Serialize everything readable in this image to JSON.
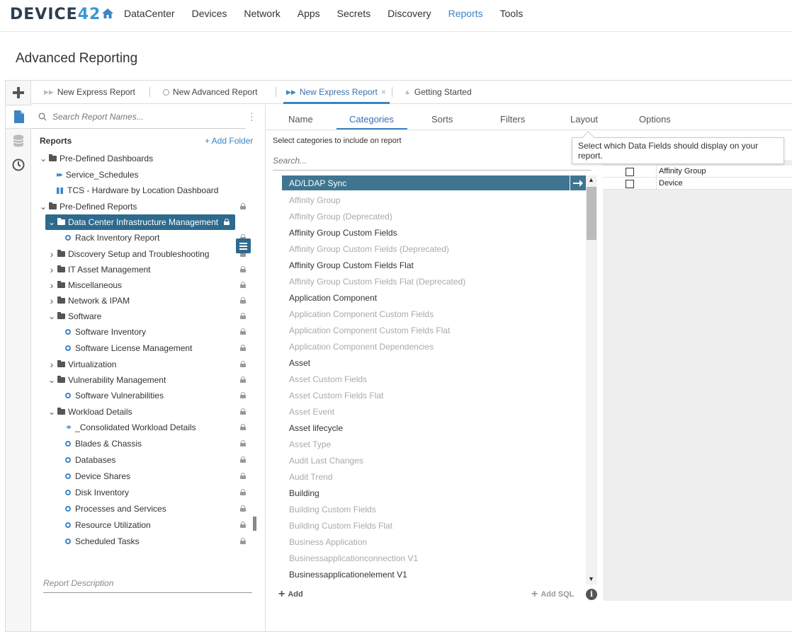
{
  "topnav": {
    "logo_text": "DEVICE",
    "logo_num": "42",
    "items": [
      {
        "label": "DataCenter"
      },
      {
        "label": "Devices"
      },
      {
        "label": "Network"
      },
      {
        "label": "Apps"
      },
      {
        "label": "Secrets"
      },
      {
        "label": "Discovery"
      },
      {
        "label": "Reports",
        "active": true
      },
      {
        "label": "Tools"
      }
    ]
  },
  "page_title": "Advanced Reporting",
  "tabs": [
    {
      "label": "New Express Report",
      "icon": "double-arrow-icon"
    },
    {
      "label": "New Advanced Report",
      "icon": "circle-icon"
    },
    {
      "label": "New Express Report",
      "icon": "double-arrow-icon",
      "active": true,
      "close": "×"
    },
    {
      "label": "Getting Started",
      "icon": "up-arrow-icon"
    }
  ],
  "left": {
    "search_placeholder": "Search Report Names...",
    "reports_header": "Reports",
    "add_folder": "+ Add Folder",
    "tree": [
      {
        "label": "Pre-Defined Dashboards",
        "type": "folder",
        "caret": "v",
        "lock": false
      },
      {
        "label": "Service_Schedules",
        "type": "dash",
        "lock": false
      },
      {
        "label": "TCS - Hardware by Location Dashboard",
        "type": "grid",
        "lock": false
      },
      {
        "label": "Pre-Defined Reports",
        "type": "folder",
        "caret": "v",
        "lock": true
      },
      {
        "label": "Data Center Infrastructure Management",
        "type": "folder",
        "caret": "v",
        "lock": true,
        "selected": true
      },
      {
        "label": "Rack Inventory Report",
        "type": "report",
        "lock": true
      },
      {
        "label": "Discovery Setup and Troubleshooting",
        "type": "folder",
        "caret": ">",
        "lock": true
      },
      {
        "label": "IT Asset Management",
        "type": "folder",
        "caret": ">",
        "lock": true
      },
      {
        "label": "Miscellaneous",
        "type": "folder",
        "caret": ">",
        "lock": true
      },
      {
        "label": "Network & IPAM",
        "type": "folder",
        "caret": ">",
        "lock": true
      },
      {
        "label": "Software",
        "type": "folder",
        "caret": "v",
        "lock": true
      },
      {
        "label": "Software Inventory",
        "type": "report",
        "lock": true
      },
      {
        "label": "Software License Management",
        "type": "report",
        "lock": true
      },
      {
        "label": "Virtualization",
        "type": "folder",
        "caret": ">",
        "lock": true
      },
      {
        "label": "Vulnerability Management",
        "type": "folder",
        "caret": "v",
        "lock": true
      },
      {
        "label": "Software Vulnerabilities",
        "type": "report",
        "lock": true
      },
      {
        "label": "Workload Details",
        "type": "folder",
        "caret": "v",
        "lock": true
      },
      {
        "label": "_Consolidated Workload Details",
        "type": "link",
        "lock": true
      },
      {
        "label": "Blades & Chassis",
        "type": "report",
        "lock": true
      },
      {
        "label": "Databases",
        "type": "report",
        "lock": true
      },
      {
        "label": "Device Shares",
        "type": "report",
        "lock": true
      },
      {
        "label": "Disk Inventory",
        "type": "report",
        "lock": true
      },
      {
        "label": "Processes and Services",
        "type": "report",
        "lock": true
      },
      {
        "label": "Resource Utilization",
        "type": "report",
        "lock": true
      },
      {
        "label": "Scheduled Tasks",
        "type": "report",
        "lock": true
      }
    ],
    "report_description_placeholder": "Report Description"
  },
  "center": {
    "subtabs": [
      {
        "label": "Name"
      },
      {
        "label": "Categories",
        "active": true
      },
      {
        "label": "Sorts"
      },
      {
        "label": "Filters"
      },
      {
        "label": "Layout"
      },
      {
        "label": "Options"
      }
    ],
    "hint": "Select categories to include on report",
    "search_placeholder": "Search...",
    "categories": [
      {
        "label": "AD/LDAP Sync",
        "state": "selected"
      },
      {
        "label": "Affinity Group",
        "state": "disabled"
      },
      {
        "label": "Affinity Group (Deprecated)",
        "state": "disabled"
      },
      {
        "label": "Affinity Group Custom Fields",
        "state": "enabled"
      },
      {
        "label": "Affinity Group Custom Fields (Deprecated)",
        "state": "disabled"
      },
      {
        "label": "Affinity Group Custom Fields Flat",
        "state": "enabled"
      },
      {
        "label": "Affinity Group Custom Fields Flat (Deprecated)",
        "state": "disabled"
      },
      {
        "label": "Application Component",
        "state": "enabled"
      },
      {
        "label": "Application Component Custom Fields",
        "state": "disabled"
      },
      {
        "label": "Application Component Custom Fields Flat",
        "state": "disabled"
      },
      {
        "label": "Application Component Dependencies",
        "state": "disabled"
      },
      {
        "label": "Asset",
        "state": "enabled"
      },
      {
        "label": "Asset Custom Fields",
        "state": "disabled"
      },
      {
        "label": "Asset Custom Fields Flat",
        "state": "disabled"
      },
      {
        "label": "Asset Event",
        "state": "disabled"
      },
      {
        "label": "Asset lifecycle",
        "state": "enabled"
      },
      {
        "label": "Asset Type",
        "state": "disabled"
      },
      {
        "label": "Audit Last Changes",
        "state": "disabled"
      },
      {
        "label": "Audit Trend",
        "state": "disabled"
      },
      {
        "label": "Building",
        "state": "enabled"
      },
      {
        "label": "Building Custom Fields",
        "state": "disabled"
      },
      {
        "label": "Building Custom Fields Flat",
        "state": "disabled"
      },
      {
        "label": "Business Application",
        "state": "disabled"
      },
      {
        "label": "Businessapplicationconnection V1",
        "state": "disabled"
      },
      {
        "label": "Businessapplicationelement V1",
        "state": "enabled"
      }
    ],
    "add_label": "Add",
    "add_sql_label": "Add SQL",
    "info_glyph": "i"
  },
  "right": {
    "rows": [
      {
        "label": "Affinity Group",
        "checked": false
      },
      {
        "label": "Device",
        "checked": false
      }
    ]
  },
  "tooltip": "Select which Data Fields should display on your report."
}
